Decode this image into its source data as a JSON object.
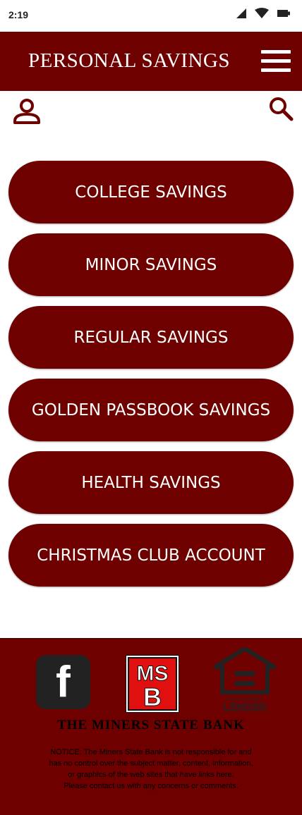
{
  "status_bar": {
    "time": "2:19",
    "icons": [
      "signal-icon",
      "wifi-icon",
      "battery-icon"
    ]
  },
  "header": {
    "title": "PERSONAL SAVINGS",
    "menu_icon": "hamburger-menu-icon"
  },
  "toolbar": {
    "user_icon": "user-icon",
    "search_icon": "search-icon"
  },
  "savings_options": [
    {
      "label": "COLLEGE SAVINGS"
    },
    {
      "label": "MINOR SAVINGS"
    },
    {
      "label": "REGULAR SAVINGS"
    },
    {
      "label": "GOLDEN PASSBOOK SAVINGS"
    },
    {
      "label": "HEALTH SAVINGS"
    },
    {
      "label": "CHRISTMAS CLUB ACCOUNT"
    }
  ],
  "footer": {
    "facebook_glyph": "f",
    "logo_letters": "MSB",
    "equal_housing_text": "EQUAL HOUSING LENDER",
    "bank_name": "THE MINERS STATE BANK",
    "notice_lines": [
      "NOTICE: The Miners State Bank is not responsible for and",
      "has no control over the subject matter, content, information,",
      "or graphics of the web sites that have links here.",
      "Please contact us with any concerns or comments."
    ]
  },
  "colors": {
    "brand": "#6e0000",
    "text_light": "#ffffff",
    "text_dark": "#000000"
  }
}
